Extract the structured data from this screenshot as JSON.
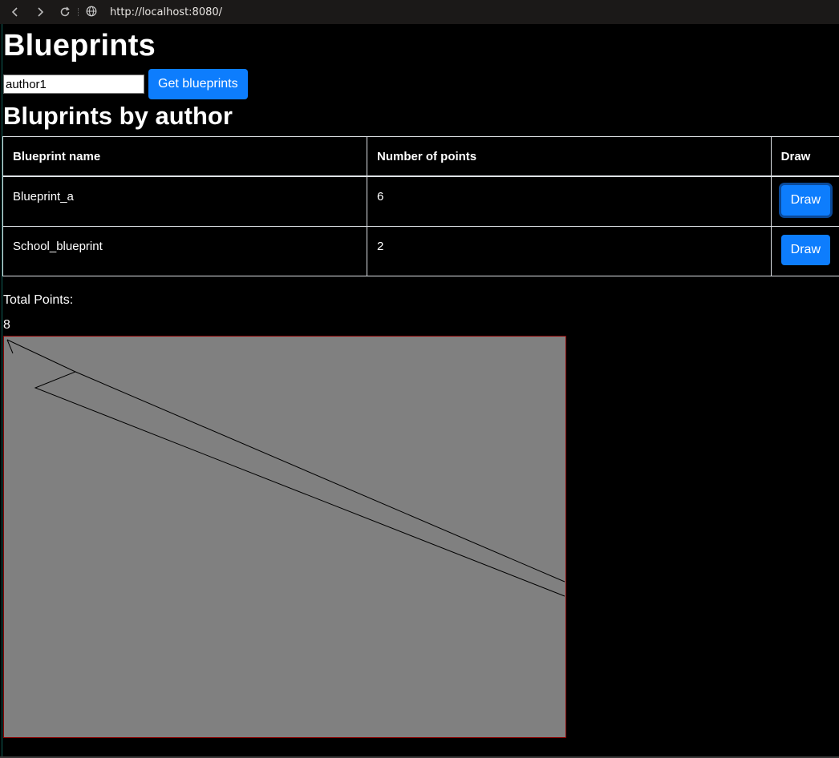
{
  "browser": {
    "url": "http://localhost:8080/"
  },
  "page": {
    "title": "Blueprints",
    "search": {
      "value": "author1"
    },
    "get_button_label": "Get blueprints",
    "subtitle": "Bluprints by author"
  },
  "table": {
    "headers": [
      "Blueprint name",
      "Number of points",
      "Draw"
    ],
    "rows": [
      {
        "name": "Blueprint_a",
        "points": "6",
        "action_label": "Draw"
      },
      {
        "name": "School_blueprint",
        "points": "2",
        "action_label": "Draw"
      }
    ]
  },
  "total": {
    "label": "Total Points:",
    "value": "8"
  },
  "canvas": {
    "background": "#808080",
    "border_color": "#8b0000",
    "stroke_color": "#000000",
    "polyline": [
      [
        5,
        5
      ],
      [
        90,
        45
      ],
      [
        40,
        65
      ],
      [
        700,
        325
      ]
    ],
    "segment": [
      [
        5,
        5
      ],
      [
        12,
        22
      ]
    ],
    "extra_line": [
      [
        90,
        45
      ],
      [
        700,
        307
      ]
    ]
  },
  "colors": {
    "accent": "#0d7dfd",
    "page_background": "#000000"
  },
  "icons": [
    "back-icon",
    "forward-icon",
    "reload-icon",
    "globe-icon"
  ]
}
